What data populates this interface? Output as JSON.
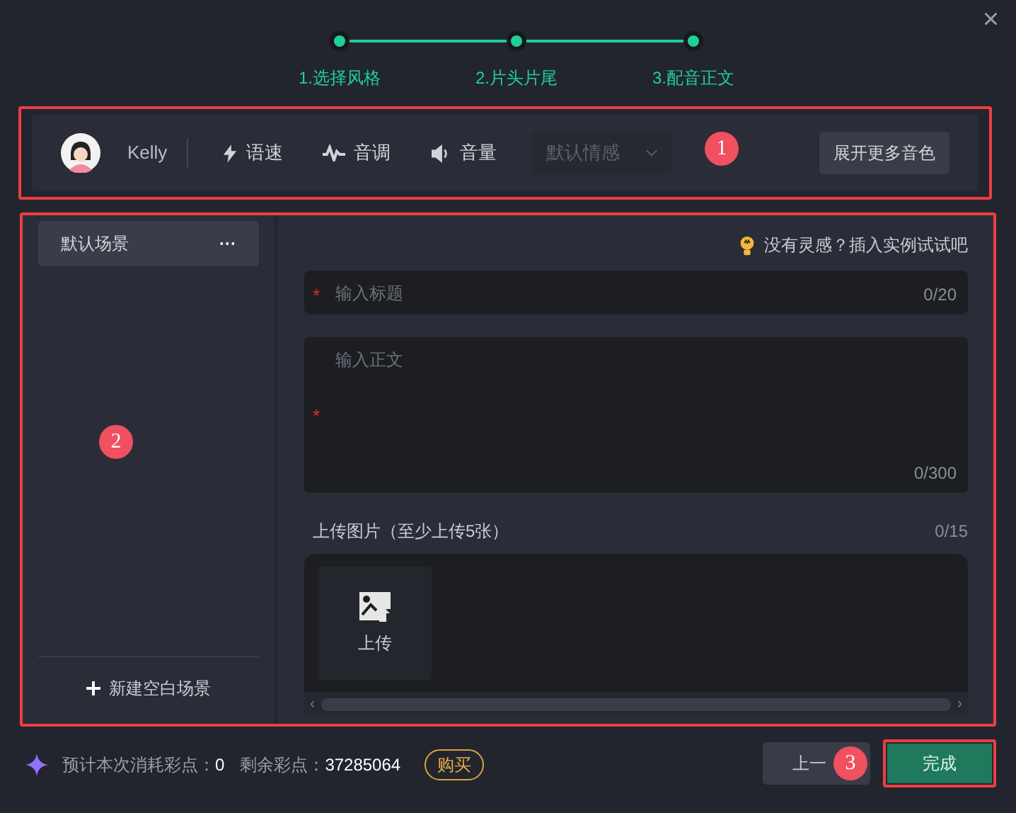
{
  "close": "×",
  "steps": [
    {
      "label": "1.选择风格"
    },
    {
      "label": "2.片头片尾"
    },
    {
      "label": "3.配音正文"
    }
  ],
  "voice_bar": {
    "name": "Kelly",
    "controls": [
      {
        "kind": "speed",
        "label": "语速"
      },
      {
        "kind": "pitch",
        "label": "音调"
      },
      {
        "kind": "volume",
        "label": "音量"
      }
    ],
    "emotion": {
      "value": "默认情感",
      "disabled": true
    },
    "more_button": "展开更多音色"
  },
  "scenes": {
    "items": [
      {
        "label": "默认场景",
        "selected": true,
        "menu": "···"
      }
    ],
    "add_button": "新建空白场景"
  },
  "editor": {
    "hint": "没有灵感？插入实例试试吧",
    "title_field": {
      "placeholder": "输入标题",
      "required": "*",
      "count": "0/20"
    },
    "body_field": {
      "placeholder": "输入正文",
      "required": "*",
      "count": "0/300"
    },
    "upload": {
      "label": "上传图片（至少上传5张）",
      "count": "0/15",
      "button": "上传",
      "scroll_left": "‹",
      "scroll_right": "›"
    }
  },
  "footer": {
    "cost_label": "预计本次消耗彩点：",
    "cost": "0",
    "balance_label": "剩余彩点：",
    "balance": "37285064",
    "buy": "购买",
    "back": "上一",
    "done": "完成"
  },
  "annotations": [
    {
      "label": "1"
    },
    {
      "label": "2"
    },
    {
      "label": "3"
    }
  ]
}
